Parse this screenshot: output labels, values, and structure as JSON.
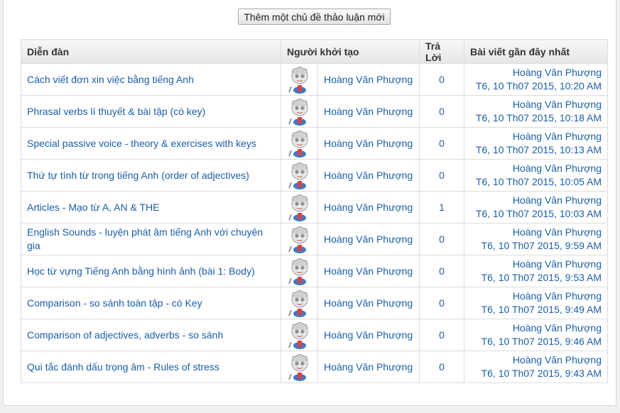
{
  "toolbar": {
    "new_topic_label": "Thêm một chủ đề thảo luận mới"
  },
  "table": {
    "headers": {
      "forum": "Diễn đàn",
      "starter": "Người khởi tạo",
      "replies": "Trả Lời",
      "last_post": "Bài viết gần đây nhất"
    },
    "rows": [
      {
        "topic": "Cách viết đơn xin việc bằng tiếng Anh",
        "author": "Hoàng Văn Phượng",
        "replies": "0",
        "last_author": "Hoàng Văn Phượng",
        "last_date": "T6, 10 Th07 2015, 10:20 AM"
      },
      {
        "topic": "Phrasal verbs lí thuyết & bài tập (có key)",
        "author": "Hoàng Văn Phượng",
        "replies": "0",
        "last_author": "Hoàng Văn Phượng",
        "last_date": "T6, 10 Th07 2015, 10:18 AM"
      },
      {
        "topic": "Special passive voice - theory & exercises with keys",
        "author": "Hoàng Văn Phượng",
        "replies": "0",
        "last_author": "Hoàng Văn Phượng",
        "last_date": "T6, 10 Th07 2015, 10:13 AM"
      },
      {
        "topic": "Thứ tự tính từ trong tiếng Anh (order of adjectives)",
        "author": "Hoàng Văn Phượng",
        "replies": "0",
        "last_author": "Hoàng Văn Phượng",
        "last_date": "T6, 10 Th07 2015, 10:05 AM"
      },
      {
        "topic": "Articles - Mạo từ A, AN & THE",
        "author": "Hoàng Văn Phượng",
        "replies": "1",
        "last_author": "Hoàng Văn Phượng",
        "last_date": "T6, 10 Th07 2015, 10:03 AM"
      },
      {
        "topic": "English Sounds - luyện phát âm tiếng Anh với chuyên gia",
        "author": "Hoàng Văn Phượng",
        "replies": "0",
        "last_author": "Hoàng Văn Phượng",
        "last_date": "T6, 10 Th07 2015, 9:59 AM"
      },
      {
        "topic": "Học từ vựng Tiếng Anh bằng hình ảnh (bài 1: Body)",
        "author": "Hoàng Văn Phượng",
        "replies": "0",
        "last_author": "Hoàng Văn Phượng",
        "last_date": "T6, 10 Th07 2015, 9:53 AM"
      },
      {
        "topic": "Comparison - so sánh toàn tập - có Key",
        "author": "Hoàng Văn Phượng",
        "replies": "0",
        "last_author": "Hoàng Văn Phượng",
        "last_date": "T6, 10 Th07 2015, 9:49 AM"
      },
      {
        "topic": "Comparison of adjectives, adverbs - so sánh",
        "author": "Hoàng Văn Phượng",
        "replies": "0",
        "last_author": "Hoàng Văn Phượng",
        "last_date": "T6, 10 Th07 2015, 9:46 AM"
      },
      {
        "topic": "Qui tắc đánh dấu trọng âm - Rules of stress",
        "author": "Hoàng Văn Phượng",
        "replies": "0",
        "last_author": "Hoàng Văn Phượng",
        "last_date": "T6, 10 Th07 2015, 9:43 AM"
      }
    ]
  },
  "icons": {
    "avatar": "cartoon-avatar-icon"
  },
  "colors": {
    "link": "#1a5ea8",
    "header_bg": "#eeeeee",
    "border": "#dddddd"
  }
}
